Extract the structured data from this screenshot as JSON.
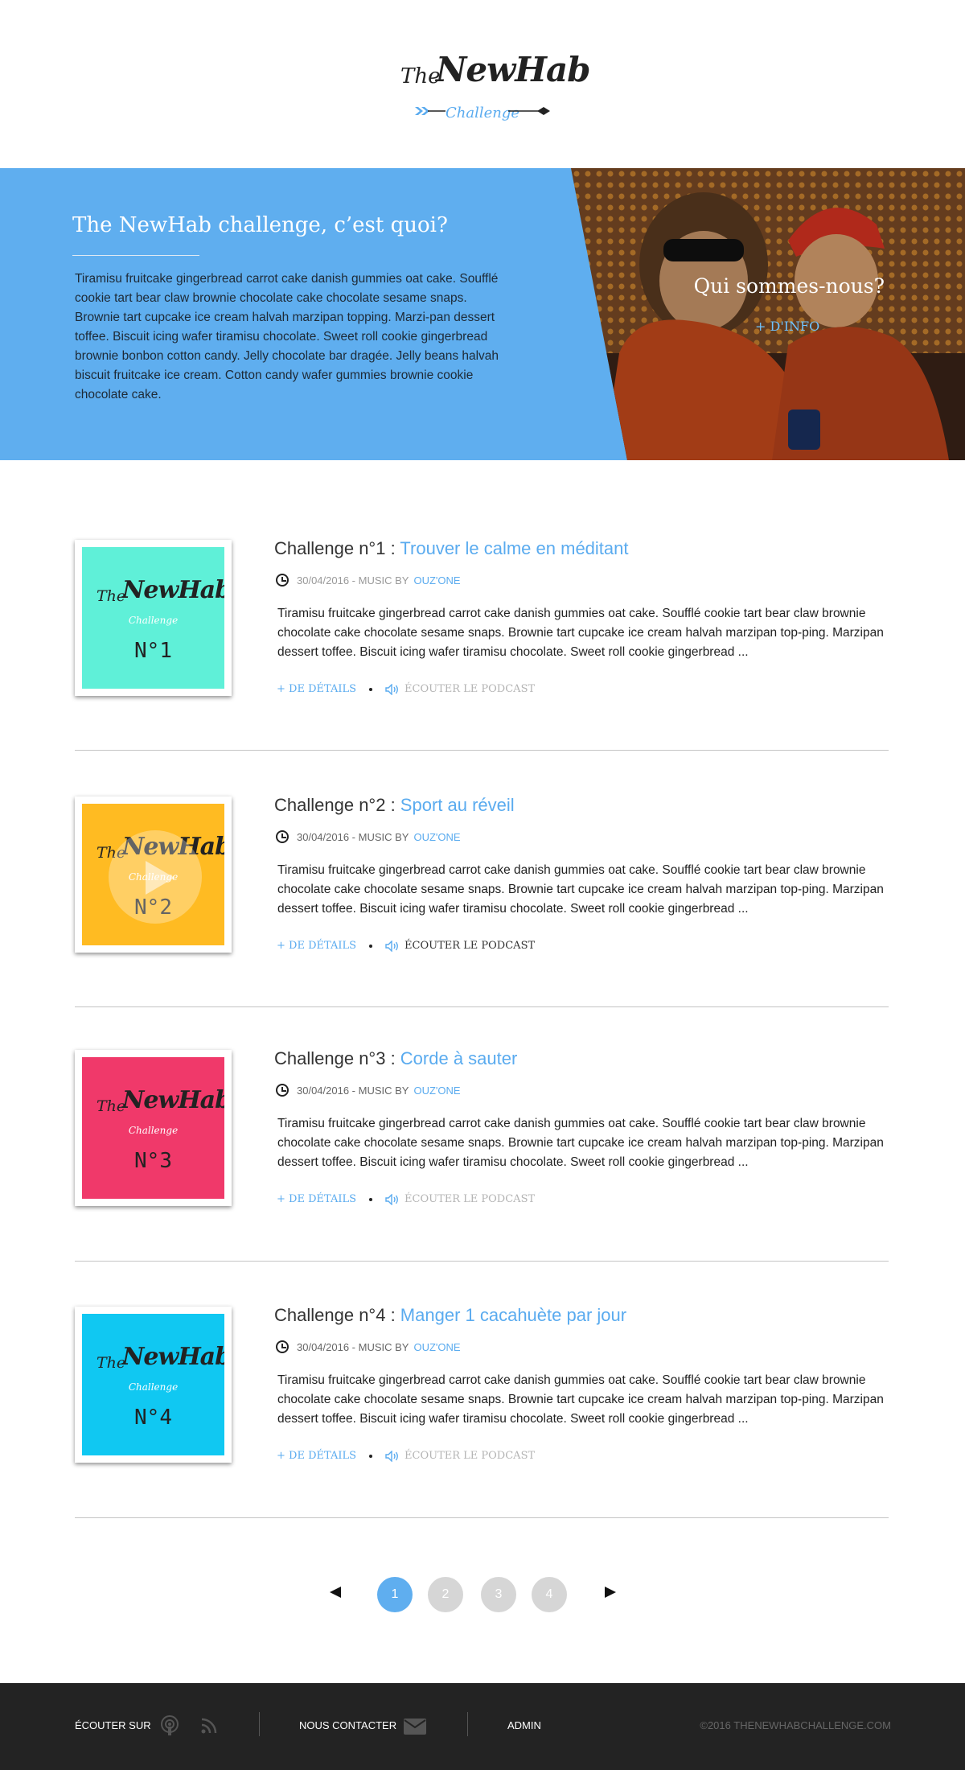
{
  "header": {
    "logo_the": "The",
    "logo_newhab": "NewHab",
    "logo_tagline": "Challenge"
  },
  "hero": {
    "title": "The NewHab challenge, c’est quoi?",
    "text": "Tiramisu fruitcake gingerbread carrot cake danish gummies oat cake. Soufflé cookie tart bear claw brownie chocolate cake chocolate sesame snaps. Brownie tart cupcake ice cream halvah marzipan topping. Marzi-pan dessert toffee. Biscuit icing wafer tiramisu chocolate. Sweet roll cookie gingerbread brownie bonbon cotton candy. Jelly chocolate bar dragée. Jelly beans halvah biscuit fruitcake ice cream. Cotton candy wafer gummies brownie cookie chocolate cake.",
    "photo_title": "Qui sommes-nous?",
    "photo_link": "+ D'INFO"
  },
  "challenges": [
    {
      "prefix": "Challenge n°1 : ",
      "name": "Trouver le calme en méditant",
      "meta": "30/04/2016 - MUSIC BY ",
      "author": "OUZ'ONE",
      "thumb_num": "N°1",
      "thumb_color": "#5ff0d8",
      "desc": "Tiramisu fruitcake gingerbread carrot cake danish gummies oat cake. Soufflé cookie tart bear claw brownie chocolate cake chocolate sesame snaps. Brownie tart cupcake ice cream halvah marzipan top-ping. Marzipan dessert toffee. Biscuit icing wafer tiramisu chocolate. Sweet roll cookie gingerbread ...",
      "details_label": "+ DE DÉTAILS",
      "podcast_label": "ÉCOUTER LE PODCAST"
    },
    {
      "prefix": "Challenge n°2 : ",
      "name": "Sport au réveil",
      "meta": "30/04/2016 - MUSIC BY ",
      "author": "OUZ'ONE",
      "thumb_num": "N°2",
      "thumb_color": "#ffbb22",
      "desc": "Tiramisu fruitcake gingerbread carrot cake danish gummies oat cake. Soufflé cookie tart bear claw brownie chocolate cake chocolate sesame snaps. Brownie tart cupcake ice cream halvah marzipan top-ping. Marzipan dessert toffee. Biscuit icing wafer tiramisu chocolate. Sweet roll cookie gingerbread ...",
      "details_label": "+ DE DÉTAILS",
      "podcast_label": "ÉCOUTER LE PODCAST"
    },
    {
      "prefix": "Challenge n°3 : ",
      "name": "Corde à sauter",
      "meta": "30/04/2016 - MUSIC BY ",
      "author": "OUZ'ONE",
      "thumb_num": "N°3",
      "thumb_color": "#f0396a",
      "desc": "Tiramisu fruitcake gingerbread carrot cake danish gummies oat cake. Soufflé cookie tart bear claw brownie chocolate cake chocolate sesame snaps. Brownie tart cupcake ice cream halvah marzipan top-ping. Marzipan dessert toffee. Biscuit icing wafer tiramisu chocolate. Sweet roll cookie gingerbread ...",
      "details_label": "+ DE DÉTAILS",
      "podcast_label": "ÉCOUTER LE PODCAST"
    },
    {
      "prefix": "Challenge n°4 : ",
      "name": "Manger 1 cacahuète par jour",
      "meta": "30/04/2016 - MUSIC BY ",
      "author": "OUZ'ONE",
      "thumb_num": "N°4",
      "thumb_color": "#10c8f2",
      "desc": "Tiramisu fruitcake gingerbread carrot cake danish gummies oat cake. Soufflé cookie tart bear claw brownie chocolate cake chocolate sesame snaps. Brownie tart cupcake ice cream halvah marzipan top-ping. Marzipan dessert toffee. Biscuit icing wafer tiramisu chocolate. Sweet roll cookie gingerbread ...",
      "details_label": "+ DE DÉTAILS",
      "podcast_label": "ÉCOUTER LE PODCAST"
    }
  ],
  "pagination": {
    "pages": [
      "1",
      "2",
      "3",
      "4"
    ],
    "current": "1"
  },
  "footer": {
    "listen": "ÉCOUTER SUR",
    "contact": "NOUS CONTACTER",
    "admin": "ADMIN",
    "copyright": "©2016 THENEWHABCHALLENGE.COM"
  },
  "colors": {
    "accent": "#5faeef",
    "footer_bg": "#232323"
  }
}
